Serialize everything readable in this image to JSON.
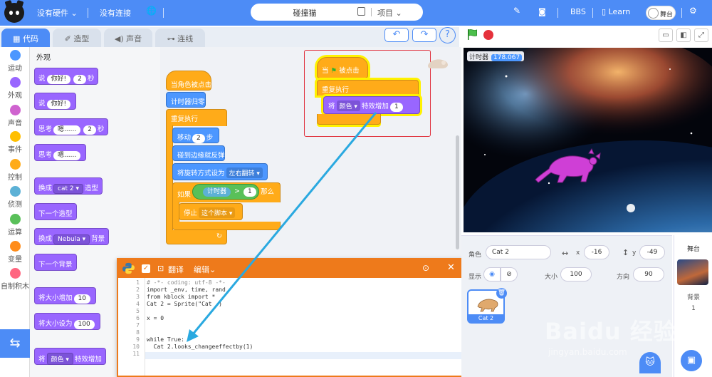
{
  "topbar": {
    "hardware": "没有硬件",
    "connection": "没有连接",
    "project_name": "碰撞猫",
    "project_menu": "项目",
    "bbs": "BBS",
    "learn": "Learn",
    "stage_toggle": "舞台"
  },
  "tabs": [
    "代码",
    "造型",
    "声音",
    "连线"
  ],
  "categories": [
    "运动",
    "外观",
    "声音",
    "事件",
    "控制",
    "侦测",
    "运算",
    "变量",
    "自制积木"
  ],
  "category_colors": [
    "#4c97ff",
    "#9966ff",
    "#cf63cf",
    "#ffbf00",
    "#ffab19",
    "#5cb1d6",
    "#59c059",
    "#ff8c1a",
    "#ff6680"
  ],
  "palette": {
    "heading": "外观",
    "blocks": [
      {
        "a": "说",
        "v": "你好!",
        "b": "2",
        "c": "秒"
      },
      {
        "a": "说",
        "v": "你好!"
      },
      {
        "a": "思考",
        "v": "嗯......",
        "b": "2",
        "c": "秒"
      },
      {
        "a": "思考",
        "v": "嗯......"
      },
      {
        "a": "换成",
        "d": "cat 2",
        "c": "造型"
      },
      {
        "a": "下一个造型"
      },
      {
        "a": "换成",
        "d": "Nebula",
        "c": "背景"
      },
      {
        "a": "下一个背景"
      },
      {
        "a": "将大小增加",
        "v": "10"
      },
      {
        "a": "将大小设为",
        "v": "100"
      },
      {
        "a": "将",
        "d": "颜色",
        "c": "特效增加"
      }
    ]
  },
  "script1": {
    "hat": "当角色被点击",
    "reset_timer": "计时器归零",
    "forever": "重复执行",
    "move": "移动",
    "move_val": "2",
    "move_unit": "步",
    "bounce": "碰到边缘就反弹",
    "rotation": "将旋转方式设为",
    "rotation_val": "左右翻转",
    "if": "如果",
    "timer": "计时器",
    "gt": ">",
    "gt_val": "1",
    "then": "那么",
    "stop": "停止",
    "stop_val": "这个脚本"
  },
  "script2": {
    "hat_a": "当",
    "hat_b": "被点击",
    "forever": "重复执行",
    "set": "将",
    "effect": "颜色",
    "change": "特效增加",
    "val": "1"
  },
  "editor": {
    "translate": "翻译",
    "edit": "编辑",
    "line_numbers": [
      "1",
      "2",
      "3",
      "4",
      "5",
      "6",
      "7",
      "8",
      "9",
      "10",
      "11"
    ],
    "lines": [
      "# -*- coding: utf-8 -*-",
      "import _env, time, rand",
      "from kblock import * ",
      "Cat 2 = Sprite(\"Cat  )",
      "",
      "x = 0",
      "",
      "",
      "while True:",
      "  Cat 2.looks_changeeffectby(1)",
      ""
    ]
  },
  "stage": {
    "timer_label": "计时器",
    "timer_value": "178.067"
  },
  "sprite_info": {
    "role_label": "角色",
    "role_name": "Cat 2",
    "x_label": "x",
    "x": "-16",
    "y_label": "y",
    "y": "-49",
    "show_label": "显示",
    "size_label": "大小",
    "size": "100",
    "direction_label": "方向",
    "direction": "90",
    "thumb_name": "Cat 2"
  },
  "stage_pane": {
    "title": "舞台",
    "backdrop_label": "背景",
    "backdrop_count": "1"
  },
  "watermark": "Baidu 经验",
  "watermark_url": "jingyan.baidu.com"
}
